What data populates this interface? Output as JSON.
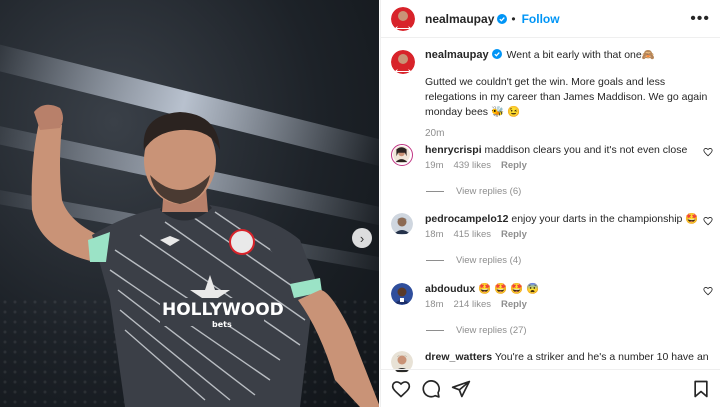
{
  "post": {
    "username": "nealmaupay",
    "follow_label": "Follow",
    "separator": "•",
    "more_label": "•••",
    "caption_username": "nealmaupay",
    "caption_line1": "Went a bit early with that one🙈",
    "caption_line2": "Gutted we couldn't get the win. More goals and less relegations in my career than James Maddison. We go again monday bees 🐝 😉",
    "caption_time": "20m"
  },
  "photo": {
    "jersey_text": "HOLLYWOOD",
    "jersey_subtext": "bets",
    "next_label": "›"
  },
  "comments": [
    {
      "username": "henrycrispi",
      "text": "maddison clears you and it's not even close",
      "time": "19m",
      "likes": "439 likes",
      "reply": "Reply",
      "view_replies": "View replies (6)"
    },
    {
      "username": "pedrocampelo12",
      "text": "enjoy your darts in the championship 🤩",
      "time": "18m",
      "likes": "415 likes",
      "reply": "Reply",
      "view_replies": "View replies (4)"
    },
    {
      "username": "abdoudux",
      "text": "🤩 🤩 🤩 😨",
      "time": "18m",
      "likes": "214 likes",
      "reply": "Reply",
      "view_replies": "View replies (27)"
    },
    {
      "username": "drew_watters",
      "text": "You're a striker and he's a number 10 have an"
    }
  ],
  "colors": {
    "accent": "#0095f6",
    "muted": "#8e8e8e",
    "text": "#262626",
    "brentford_red": "#d8232a"
  },
  "icons": [
    "verified-icon",
    "more-icon",
    "heart-icon",
    "comment-icon",
    "share-icon",
    "bookmark-icon",
    "chevron-right-icon"
  ]
}
